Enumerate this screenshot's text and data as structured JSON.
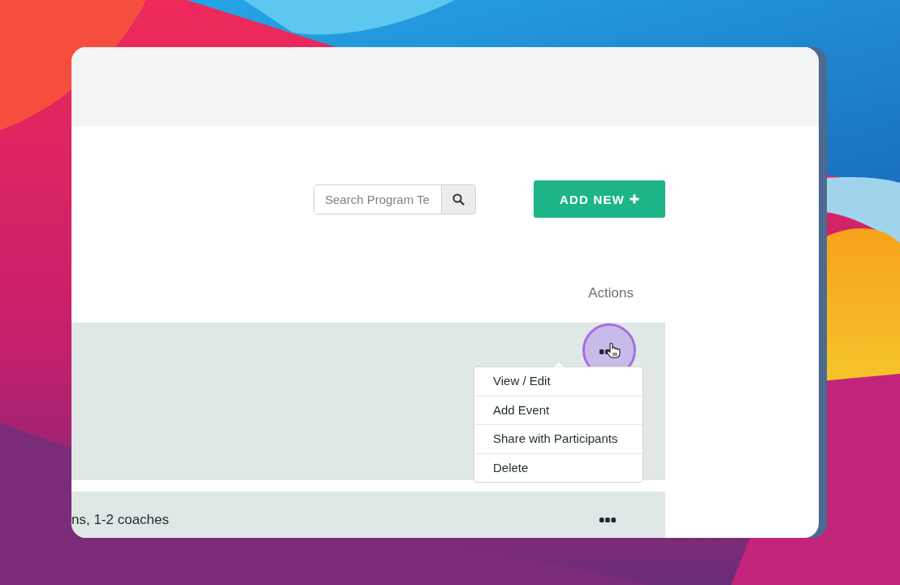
{
  "search": {
    "placeholder": "Search Program Te"
  },
  "add_button": {
    "label": "ADD NEW"
  },
  "table": {
    "columns": [
      {
        "label": "Actions"
      }
    ],
    "rows": [
      {
        "menu_open": true
      },
      {
        "text": "ns, 1-2 coaches",
        "menu_open": false
      }
    ]
  },
  "actions_menu": {
    "items": [
      {
        "label": "View / Edit"
      },
      {
        "label": "Add Event"
      },
      {
        "label": "Share with Participants"
      },
      {
        "label": "Delete"
      }
    ]
  }
}
